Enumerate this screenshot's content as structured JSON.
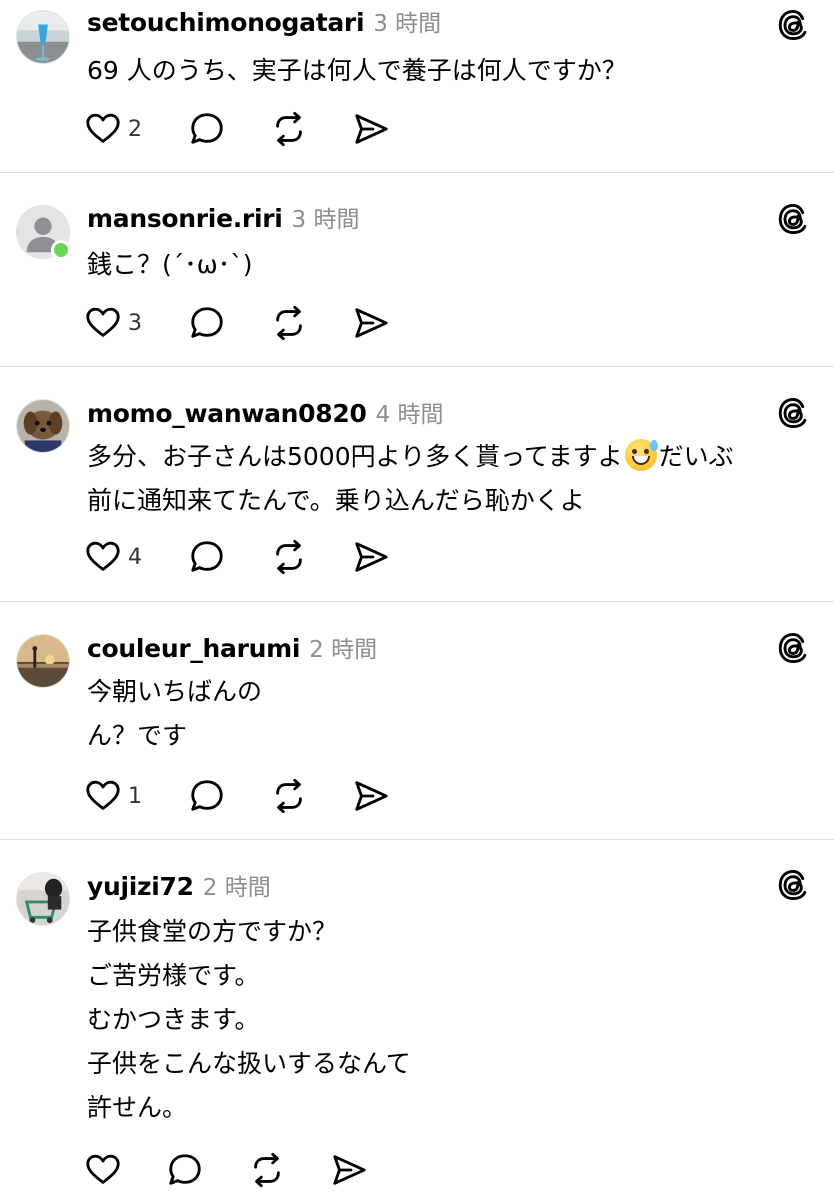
{
  "posts": [
    {
      "username": "setouchimonogatari",
      "time": "3 時間",
      "lines": [
        "69 人のうち、実子は何人で養子は何人ですか？"
      ],
      "likes": "2"
    },
    {
      "username": "mansonrie.riri",
      "time": "3 時間",
      "lines": [
        "銭こ？(´･ω･`)"
      ],
      "likes": "3"
    },
    {
      "username": "momo_wanwan0820",
      "time": "4 時間",
      "line1_before": "多分、お子さんは5000円より多く貰ってますよ",
      "line1_after": "だいぶ",
      "lines": [
        "前に通知来てたんで。乗り込んだら恥かくよ"
      ],
      "likes": "4",
      "emoji_icon": "grinning-face-with-sweat-emoji"
    },
    {
      "username": "couleur_harumi",
      "time": "2 時間",
      "lines": [
        "今朝いちばんの",
        "ん？です"
      ],
      "likes": "1"
    },
    {
      "username": "yujizi72",
      "time": "2 時間",
      "lines": [
        "子供食堂の方ですか？",
        "ご苦労様です。",
        "むかつきます。",
        "子供をこんな扱いするなんて",
        "許せん。"
      ],
      "likes": ""
    }
  ],
  "icons": {
    "like": "heart-icon",
    "reply": "comment-bubble-icon",
    "repost": "repost-icon",
    "share": "send-icon",
    "brand": "threads-logo-icon"
  },
  "colors": {
    "text": "#000000",
    "time": "#8e8e8e",
    "separator": "#dcdcdc",
    "online": "#6bd65a"
  }
}
